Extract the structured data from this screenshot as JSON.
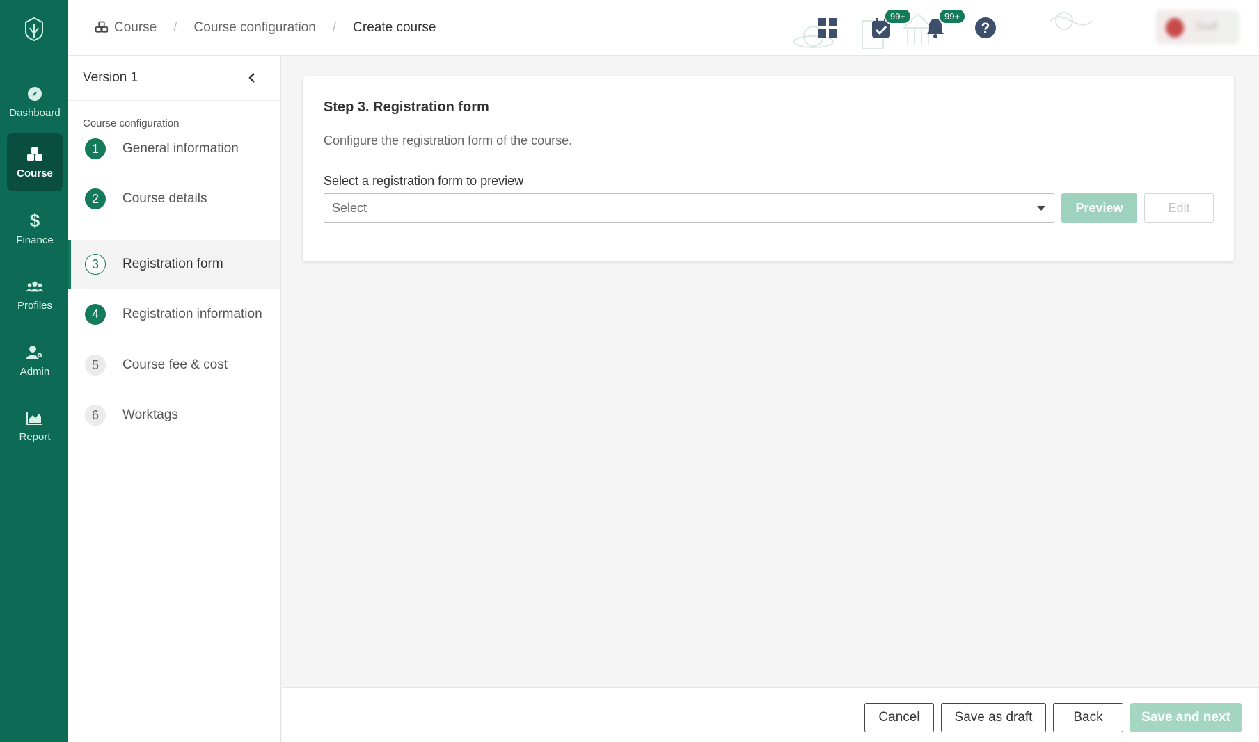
{
  "nav": {
    "items": [
      {
        "label": "Dashboard",
        "icon": "compass-icon"
      },
      {
        "label": "Course",
        "icon": "cubes-icon",
        "active": true
      },
      {
        "label": "Finance",
        "icon": "dollar-icon"
      },
      {
        "label": "Profiles",
        "icon": "users-icon"
      },
      {
        "label": "Admin",
        "icon": "user-gear-icon"
      },
      {
        "label": "Report",
        "icon": "area-chart-icon"
      }
    ]
  },
  "header": {
    "breadcrumb": [
      "Course",
      "Course configuration",
      "Create course"
    ],
    "badges": {
      "tasks": "99+",
      "notifications": "99+"
    },
    "user_name": "Staff"
  },
  "sidebar": {
    "version": "Version 1",
    "section_title": "Course configuration",
    "steps": [
      {
        "num": "1",
        "label": "General information",
        "state": "done"
      },
      {
        "num": "2",
        "label": "Course details",
        "state": "done"
      },
      {
        "num": "3",
        "label": "Registration form",
        "state": "current"
      },
      {
        "num": "4",
        "label": "Registration information",
        "state": "done"
      },
      {
        "num": "5",
        "label": "Course fee & cost",
        "state": "todo"
      },
      {
        "num": "6",
        "label": "Worktags",
        "state": "todo"
      }
    ]
  },
  "main": {
    "title": "Step 3. Registration form",
    "description": "Configure the registration form of the course.",
    "select_label": "Select a registration form to preview",
    "select_placeholder": "Select",
    "preview_label": "Preview",
    "edit_label": "Edit"
  },
  "footer": {
    "cancel": "Cancel",
    "save_draft": "Save as draft",
    "back": "Back",
    "save_next": "Save and next"
  },
  "colors": {
    "brand": "#0d6b55",
    "accent": "#137a5a",
    "disabled_primary": "#a4d6c1"
  }
}
